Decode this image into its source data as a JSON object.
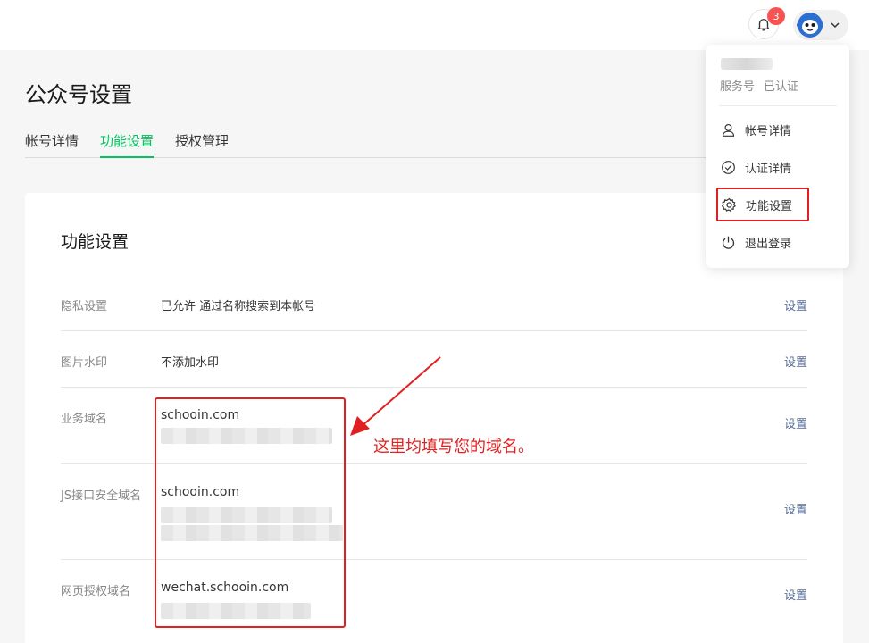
{
  "header": {
    "notification_count": "3",
    "bell_icon": "bell-icon",
    "avatar_icon": "monkey-avatar",
    "chevron_icon": "chevron-down-icon"
  },
  "page": {
    "title": "公众号设置",
    "tabs": [
      {
        "label": "帐号详情",
        "active": false
      },
      {
        "label": "功能设置",
        "active": true
      },
      {
        "label": "授权管理",
        "active": false
      }
    ]
  },
  "card": {
    "title": "功能设置",
    "rows": [
      {
        "label": "隐私设置",
        "value": "已允许 通过名称搜索到本帐号",
        "action": "设置"
      },
      {
        "label": "图片水印",
        "value": "不添加水印",
        "action": "设置"
      },
      {
        "label": "业务域名",
        "value": "schooin.com",
        "action": "设置"
      },
      {
        "label": "JS接口安全域名",
        "value": "schooin.com",
        "action": "设置"
      },
      {
        "label": "网页授权域名",
        "value": "wechat.schooin.com",
        "action": "设置"
      }
    ]
  },
  "annotation": {
    "text": "这里均填写您的域名。",
    "color": "#e02020"
  },
  "dropdown": {
    "account_type": "服务号",
    "verified": "已认证",
    "items": [
      {
        "label": "帐号详情",
        "icon": "user-icon"
      },
      {
        "label": "认证详情",
        "icon": "check-circle-icon"
      },
      {
        "label": "功能设置",
        "icon": "gear-icon"
      },
      {
        "label": "退出登录",
        "icon": "power-icon"
      }
    ]
  },
  "colors": {
    "accent": "#07c160",
    "link": "#576b95",
    "highlight": "#e02020",
    "badge": "#fa5151"
  }
}
